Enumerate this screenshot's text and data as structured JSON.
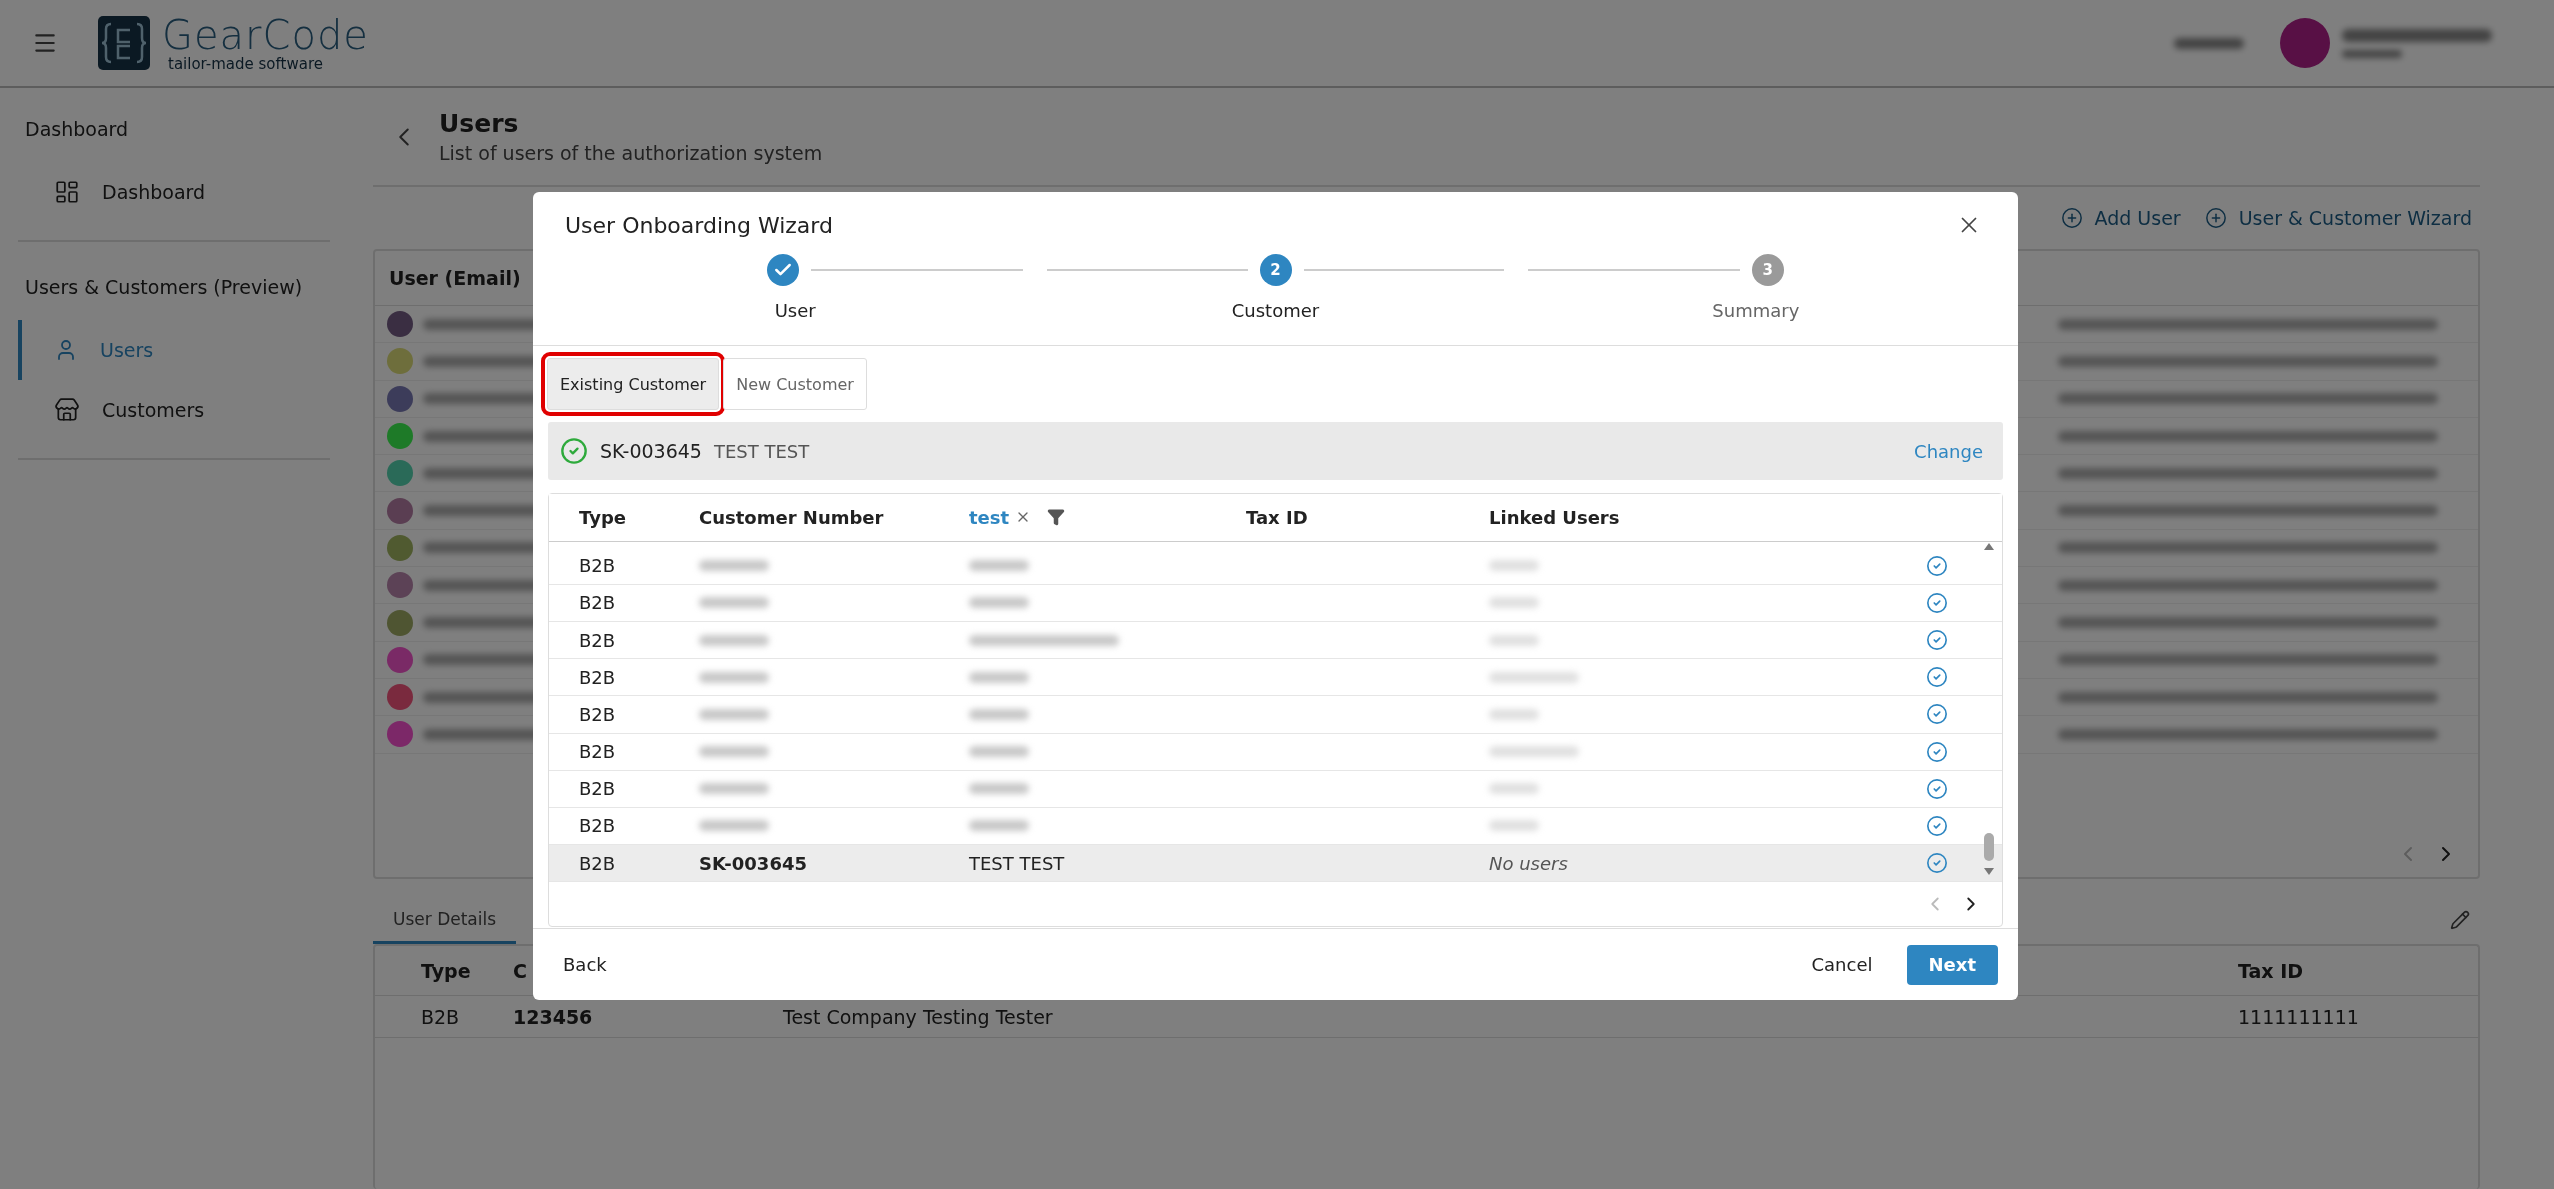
{
  "header": {
    "logo": {
      "name": "GearCode",
      "tagline": "tailor-made software"
    }
  },
  "sidebar": {
    "sections": [
      {
        "title": "Dashboard",
        "items": [
          {
            "label": "Dashboard",
            "kind": "dashboard",
            "selected": false
          }
        ]
      },
      {
        "title": "Users & Customers (Preview)",
        "items": [
          {
            "label": "Users",
            "kind": "user",
            "selected": true
          },
          {
            "label": "Customers",
            "kind": "store",
            "selected": false
          }
        ]
      }
    ]
  },
  "page": {
    "title": "Users",
    "subtitle": "List of users of the authorization system",
    "actions": [
      "Add User",
      "User & Customer Wizard"
    ]
  },
  "users_table": {
    "column_1": "User (Email)",
    "rows": [
      {
        "color": "#3a2e42"
      },
      {
        "color": "#6e6e3c"
      },
      {
        "color": "#3c3c5a"
      },
      {
        "color": "#1e7a28"
      },
      {
        "color": "#2a6a58"
      },
      {
        "color": "#5a3e52"
      },
      {
        "color": "#505a30"
      },
      {
        "color": "#5c4256"
      },
      {
        "color": "#4f5532"
      },
      {
        "color": "#7a2a66"
      },
      {
        "color": "#7a2a3e"
      },
      {
        "color": "#7c2868"
      }
    ],
    "pagination": {
      "prev_disabled": true,
      "next_disabled": false
    }
  },
  "details": {
    "tabs": [
      {
        "label": "User Details",
        "selected": true
      }
    ],
    "columns": [
      "Type",
      "C",
      "Tax ID"
    ],
    "rows": [
      {
        "type": "B2B",
        "number": "123456",
        "name": "Test Company Testing Tester",
        "tax_id": "1111111111"
      }
    ]
  },
  "wizard": {
    "title": "User Onboarding Wizard",
    "steps": [
      {
        "label": "User",
        "kind": "done"
      },
      {
        "label": "Customer",
        "number": "2",
        "kind": "active"
      },
      {
        "label": "Summary",
        "number": "3",
        "kind": "pending"
      }
    ],
    "tabs": [
      {
        "label": "Existing Customer",
        "selected": true,
        "highlighted": true
      },
      {
        "label": "New Customer",
        "selected": false,
        "highlighted": false
      }
    ],
    "selection": {
      "number": "SK-003645",
      "name": "TEST TEST",
      "action": "Change"
    },
    "columns": [
      {
        "label": "Type",
        "kind": "text"
      },
      {
        "label": "Customer Number",
        "kind": "text"
      },
      {
        "label": "test",
        "kind": "filter"
      },
      {
        "label": "Tax ID",
        "kind": "text"
      },
      {
        "label": "Linked Users",
        "kind": "text"
      }
    ],
    "rows": [
      {
        "type": "B2B",
        "blurred": true,
        "selected": false
      },
      {
        "type": "B2B",
        "blurred": true,
        "selected": false
      },
      {
        "type": "B2B",
        "blurred": true,
        "selected": false
      },
      {
        "type": "B2B",
        "blurred": true,
        "selected": false
      },
      {
        "type": "B2B",
        "blurred": true,
        "selected": false
      },
      {
        "type": "B2B",
        "blurred": true,
        "selected": false
      },
      {
        "type": "B2B",
        "blurred": true,
        "selected": false
      },
      {
        "type": "B2B",
        "blurred": true,
        "selected": false
      },
      {
        "type": "B2B",
        "blurred": false,
        "selected": true,
        "number": "SK-003645",
        "name": "TEST TEST",
        "linked_users": "No users"
      }
    ],
    "pagination": {
      "prev_disabled": true,
      "next_disabled": false
    },
    "footer": {
      "back": "Back",
      "cancel": "Cancel",
      "next": "Next"
    }
  }
}
